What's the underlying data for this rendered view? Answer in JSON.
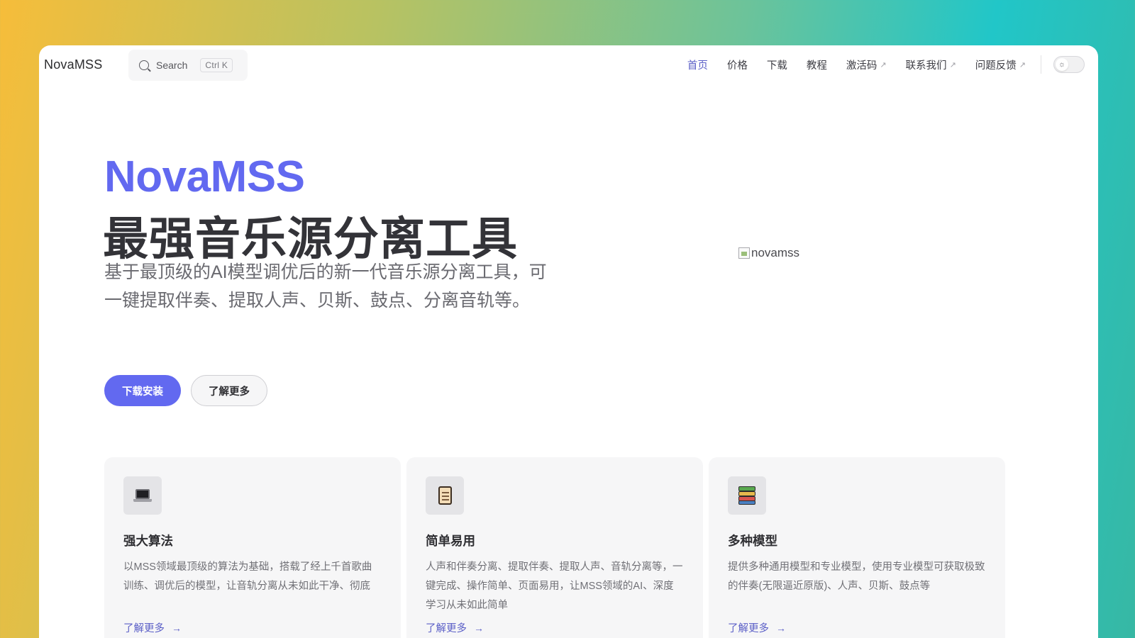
{
  "nav": {
    "brand": "NovaMSS",
    "search_placeholder": "Search",
    "search_shortcut": "Ctrl K",
    "items": [
      {
        "label": "首页",
        "active": true,
        "external": false
      },
      {
        "label": "价格",
        "active": false,
        "external": false
      },
      {
        "label": "下载",
        "active": false,
        "external": false
      },
      {
        "label": "教程",
        "active": false,
        "external": false
      },
      {
        "label": "激活码",
        "active": false,
        "external": true
      },
      {
        "label": "联系我们",
        "active": false,
        "external": true
      },
      {
        "label": "问题反馈",
        "active": false,
        "external": true
      }
    ],
    "external_glyph": "↗",
    "theme_toggle_icon": "sun-icon"
  },
  "hero": {
    "name": "NovaMSS",
    "title": "最强音乐源分离工具",
    "description": "基于最顶级的AI模型调优后的新一代音乐源分离工具，可一键提取伴奏、提取人声、贝斯、鼓点、分离音轨等。",
    "primary_button": "下载安装",
    "secondary_button": "了解更多",
    "image_alt": "novamss"
  },
  "features": [
    {
      "icon": "laptop-icon",
      "title": "强大算法",
      "description": "以MSS领域最顶级的算法为基础，搭载了经上千首歌曲训练、调优后的模型，让音轨分离从未如此干净、彻底",
      "link": "了解更多"
    },
    {
      "icon": "scroll-icon",
      "title": "简单易用",
      "description": "人声和伴奏分离、提取伴奏、提取人声、音轨分离等，一键完成、操作简单、页面易用，让MSS领域的AI、深度学习从未如此简单",
      "link": "了解更多"
    },
    {
      "icon": "books-icon",
      "title": "多种模型",
      "description": "提供多种通用模型和专业模型，使用专业模型可获取极致的伴奏(无限逼近原版)、人声、贝斯、鼓点等",
      "link": "了解更多"
    }
  ],
  "colors": {
    "accent": "#6269f0",
    "link": "#5b5fc7",
    "card_bg": "#f6f6f7"
  }
}
